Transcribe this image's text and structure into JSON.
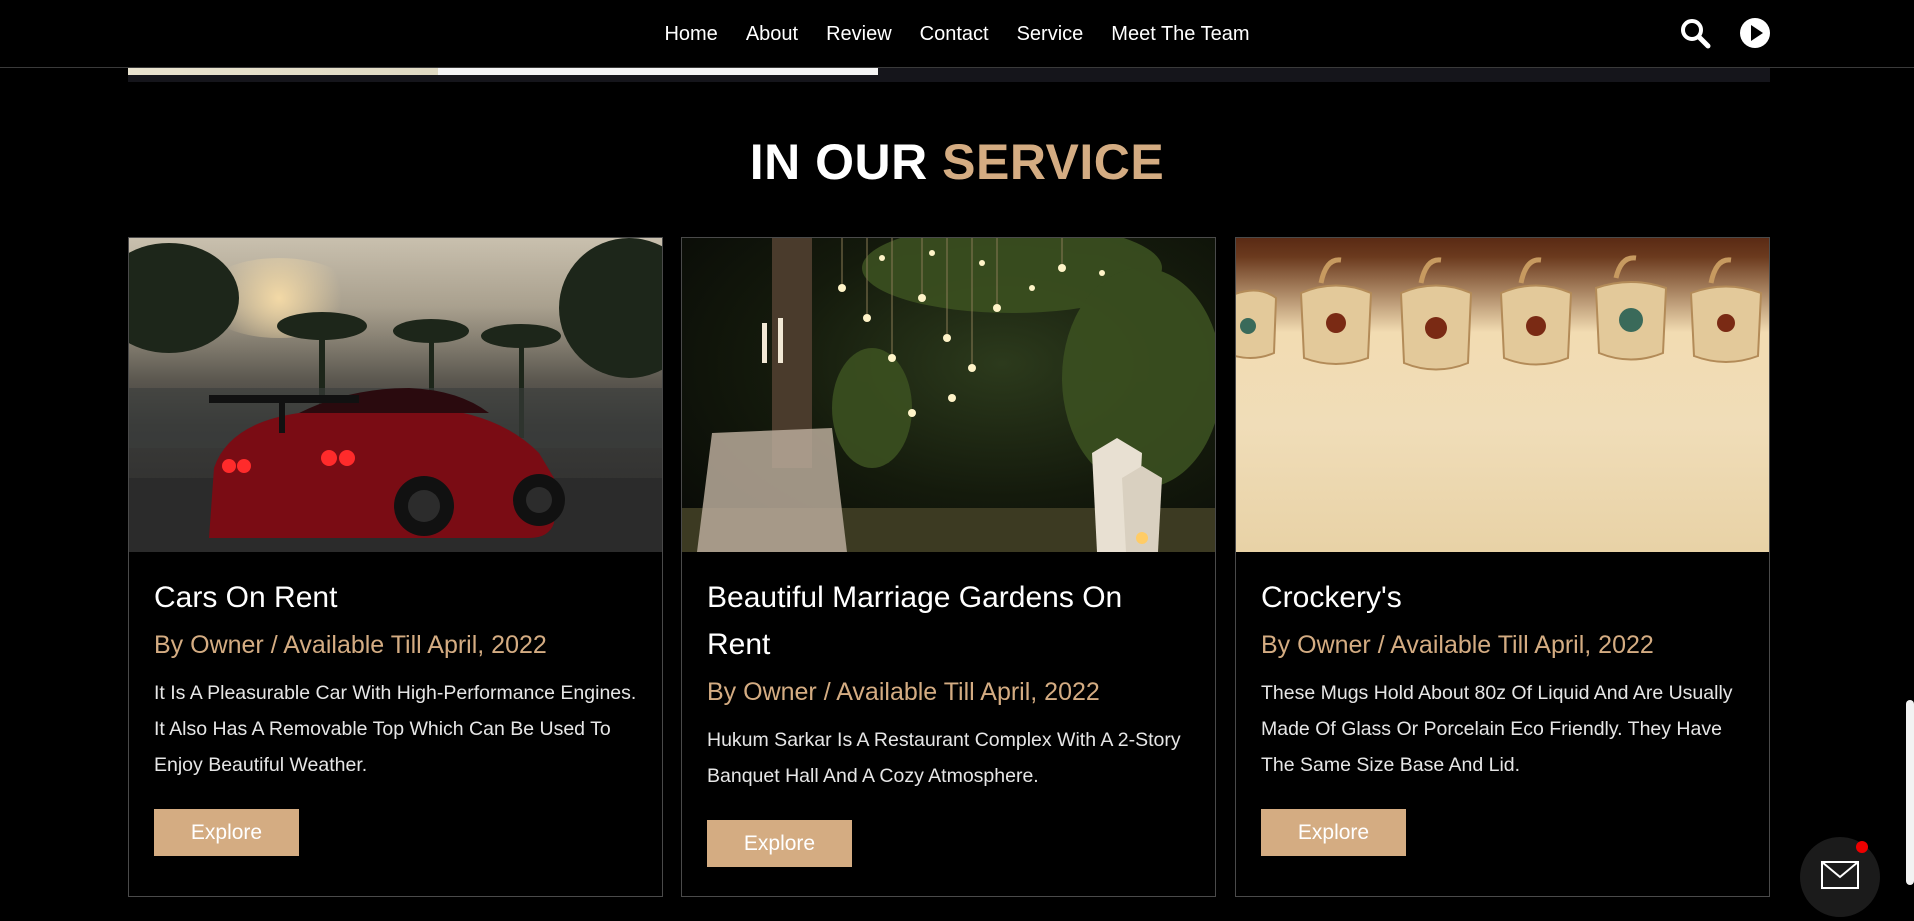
{
  "nav": {
    "items": [
      "Home",
      "About",
      "Review",
      "Contact",
      "Service",
      "Meet The Team"
    ]
  },
  "header_icons": {
    "search": "search-icon",
    "play": "play-icon"
  },
  "section": {
    "title_main": "IN OUR",
    "title_accent": "SERVICE"
  },
  "cards": [
    {
      "title": "Cars On Rent",
      "meta": "By Owner / Available Till April, 2022",
      "description": "It Is A Pleasurable Car With High-Performance Engines. It Also Has A Removable Top Which Can Be Used To Enjoy Beautiful Weather.",
      "button": "Explore",
      "image": "red-sports-car-image"
    },
    {
      "title": "Beautiful Marriage Gardens On Rent",
      "meta": "By Owner / Available Till April, 2022",
      "description": "Hukum Sarkar Is A Restaurant Complex With A 2-Story Banquet Hall And A Cozy Atmosphere.",
      "button": "Explore",
      "image": "garden-lights-image"
    },
    {
      "title": "Crockery's",
      "meta": "By Owner / Available Till April, 2022",
      "description": "These Mugs Hold About 80z Of Liquid And Are Usually Made Of Glass Or Porcelain Eco Friendly. They Have The Same Size Base And Lid.",
      "button": "Explore",
      "image": "hanging-mugs-image"
    }
  ],
  "colors": {
    "accent": "#d4ac82",
    "background": "#000000",
    "notification": "#e00000"
  },
  "fab": {
    "icon": "mail-icon"
  }
}
